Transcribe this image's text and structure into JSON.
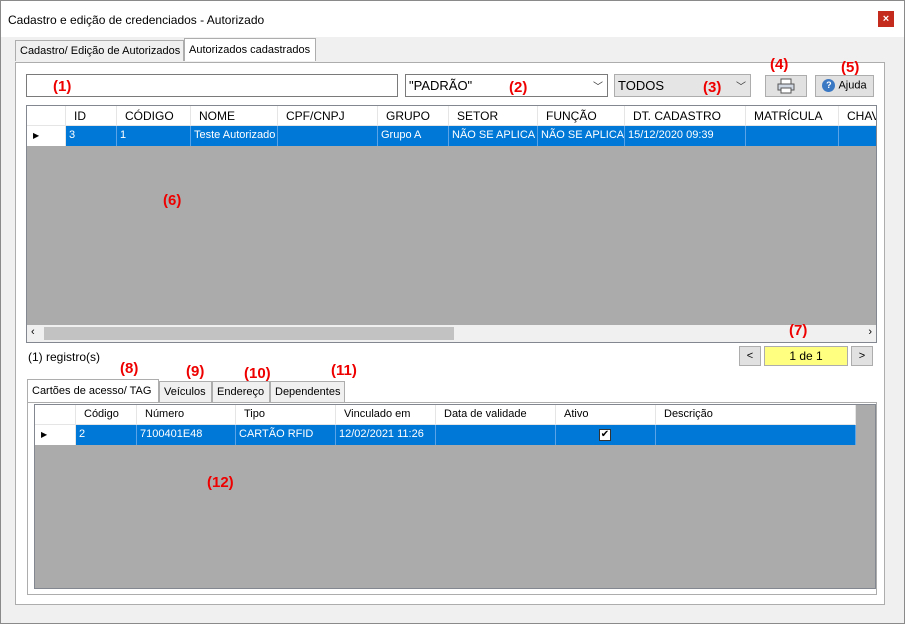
{
  "window": {
    "title": "Cadastro e edição de credenciados - Autorizado",
    "close_label": "×"
  },
  "main_tabs": [
    {
      "label": "Cadastro/ Edição de Autorizados"
    },
    {
      "label": "Autorizados cadastrados"
    }
  ],
  "toolbar": {
    "filter_combo_value": "\"PADRÃO\"",
    "status_combo_value": "TODOS",
    "help_label": "Ajuda",
    "print_icon": "printer-icon",
    "help_icon": "question-icon"
  },
  "markers": [
    "(1)",
    "(2)",
    "(3)",
    "(4)",
    "(5)",
    "(6)",
    "(7)",
    "(8)",
    "(9)",
    "(10)",
    "(11)",
    "(12)"
  ],
  "main_grid": {
    "columns": [
      "ID",
      "CÓDIGO",
      "NOME",
      "CPF/CNPJ",
      "GRUPO",
      "SETOR",
      "FUNÇÃO",
      "DT. CADASTRO",
      "MATRÍCULA",
      "CHAV"
    ],
    "rows": [
      [
        "3",
        "1",
        "Teste Autorizado",
        "",
        "Grupo A",
        "NÃO SE APLICA",
        "NÃO SE APLICA",
        "15/12/2020 09:39",
        "",
        ""
      ]
    ]
  },
  "records_label": "(1) registro(s)",
  "pager": {
    "value": "1 de 1",
    "prev": "<",
    "next": ">"
  },
  "sub_tabs": [
    {
      "label": "Cartões de acesso/ TAG"
    },
    {
      "label": "Veículos"
    },
    {
      "label": "Endereço"
    },
    {
      "label": "Dependentes"
    }
  ],
  "sub_grid": {
    "columns": [
      "Código",
      "Número",
      "Tipo",
      "Vinculado em",
      "Data de validade",
      "Ativo",
      "Descrição"
    ],
    "rows": [
      [
        "2",
        "7100401E48",
        "CARTÃO RFID",
        "12/02/2021 11:26",
        "",
        "✔",
        ""
      ]
    ]
  }
}
